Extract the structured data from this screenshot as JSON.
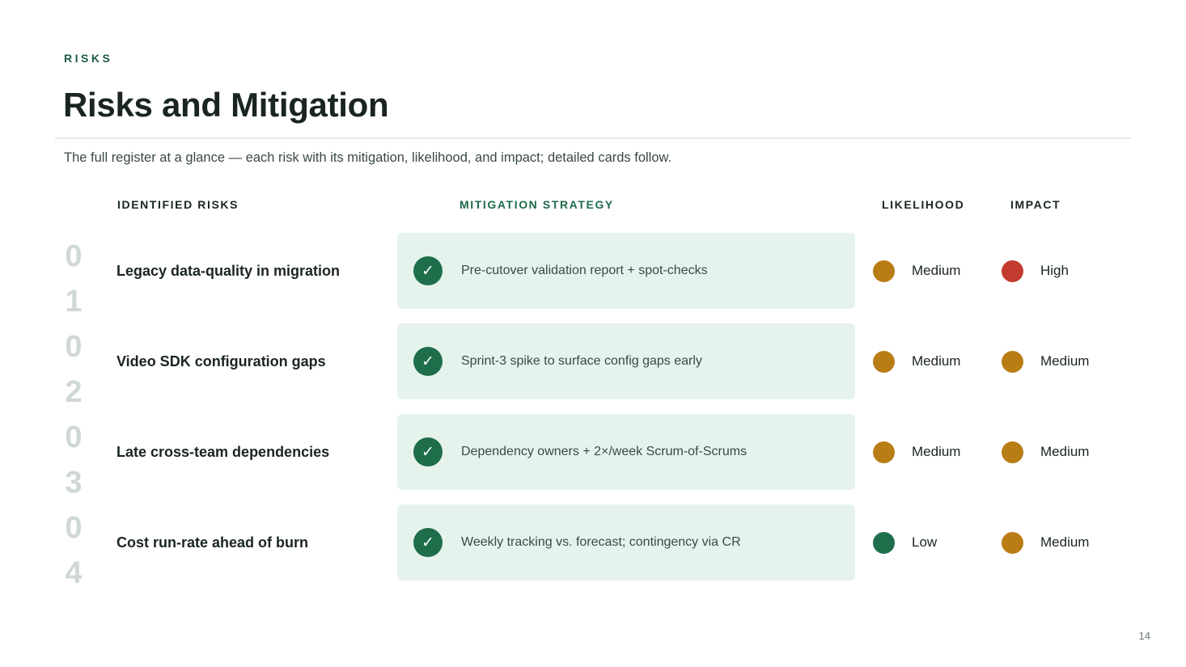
{
  "slide": {
    "eyebrow": "RISKS",
    "title": "Risks and Mitigation",
    "subtitle": "The full register at a glance — each risk with its mitigation, likelihood, and impact; detailed cards follow.",
    "page_number": "14"
  },
  "columns": {
    "risks": "IDENTIFIED RISKS",
    "mitigation": "MITIGATION STRATEGY",
    "likelihood": "LIKELIHOOD",
    "impact": "IMPACT"
  },
  "index_digits": [
    "0",
    "1",
    "0",
    "2",
    "0",
    "3",
    "0",
    "4"
  ],
  "colors": {
    "accent_green": "#1f6e4b",
    "card_bg": "#e6f3ec",
    "medium": "#b97d15",
    "high": "#c23b2e",
    "low": "#1f6e4b",
    "index_gray": "#cfd8d3"
  },
  "rows": [
    {
      "risk": "Legacy data-quality in migration",
      "mitigation": "Pre-cutover validation report + spot-checks",
      "mitigation_icon": "check-icon",
      "likelihood": "Medium",
      "likelihood_color": "#b97d15",
      "impact": "High",
      "impact_color": "#c23b2e"
    },
    {
      "risk": "Video SDK configuration gaps",
      "mitigation": "Sprint-3 spike to surface config gaps early",
      "mitigation_icon": "check-icon",
      "likelihood": "Medium",
      "likelihood_color": "#b97d15",
      "impact": "Medium",
      "impact_color": "#b97d15"
    },
    {
      "risk": "Late cross-team dependencies",
      "mitigation": "Dependency owners + 2×/week Scrum-of-Scrums",
      "mitigation_icon": "check-icon",
      "likelihood": "Medium",
      "likelihood_color": "#b97d15",
      "impact": "Medium",
      "impact_color": "#b97d15"
    },
    {
      "risk": "Cost run-rate ahead of burn",
      "mitigation": "Weekly tracking vs. forecast; contingency via CR",
      "mitigation_icon": "check-icon",
      "likelihood": "Low",
      "likelihood_color": "#1f6e4b",
      "impact": "Medium",
      "impact_color": "#b97d15"
    }
  ]
}
